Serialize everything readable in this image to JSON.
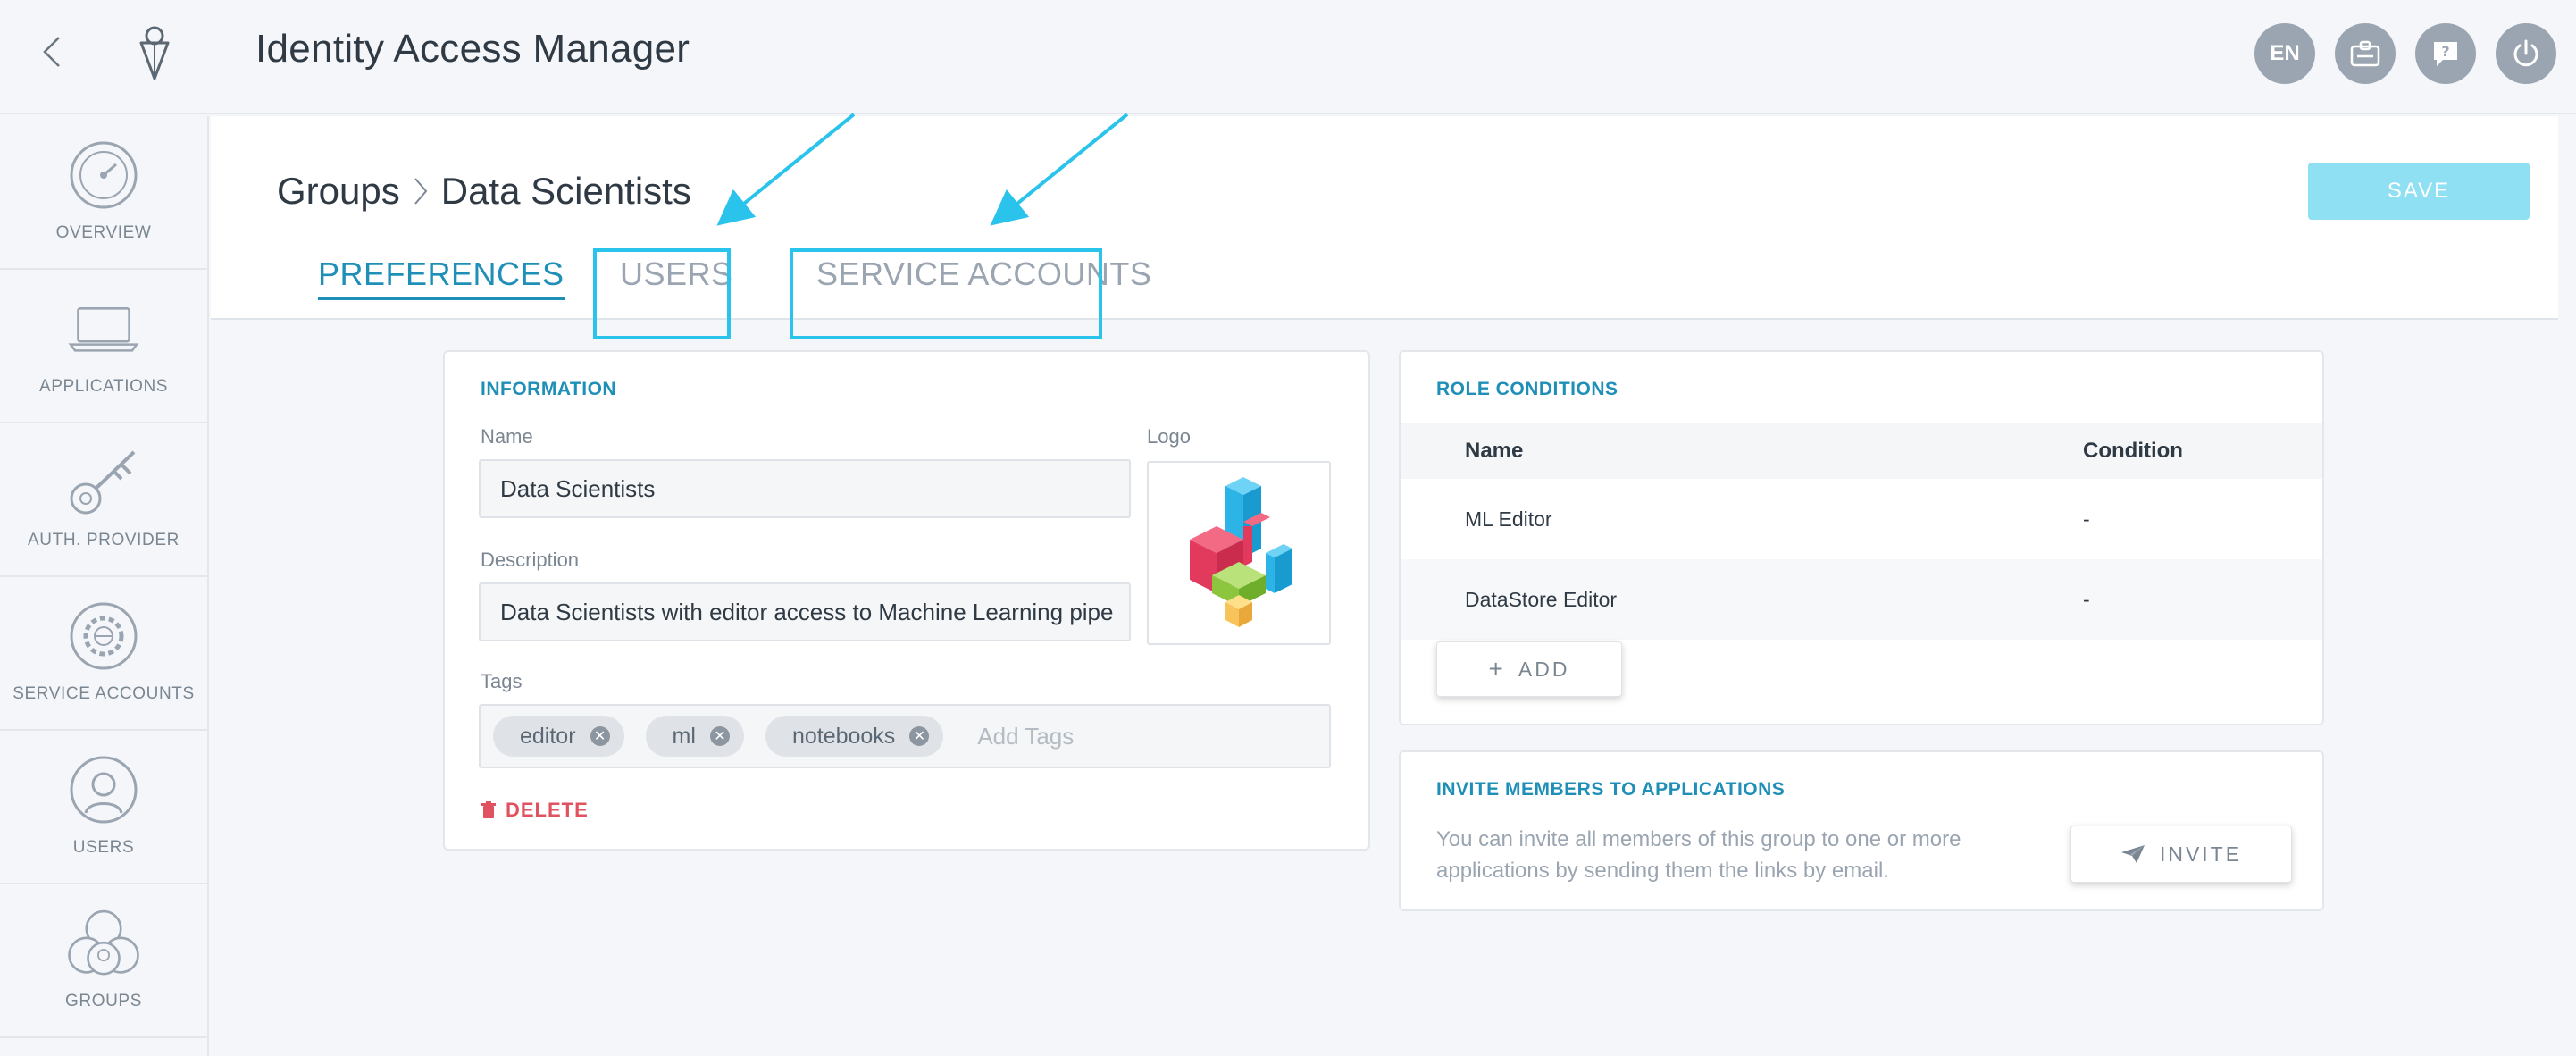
{
  "header": {
    "title": "Identity Access Manager",
    "language": "EN"
  },
  "sidebar": {
    "items": [
      {
        "label": "OVERVIEW",
        "icon": "speedometer-icon"
      },
      {
        "label": "APPLICATIONS",
        "icon": "laptop-icon"
      },
      {
        "label": "AUTH. PROVIDER",
        "icon": "key-icon"
      },
      {
        "label": "SERVICE ACCOUNTS",
        "icon": "gear-globe-icon"
      },
      {
        "label": "USERS",
        "icon": "user-icon"
      },
      {
        "label": "GROUPS",
        "icon": "group-icon"
      }
    ]
  },
  "page": {
    "breadcrumb_root": "Groups",
    "breadcrumb_current": "Data Scientists",
    "save_label": "SAVE",
    "tabs": [
      "PREFERENCES",
      "USERS",
      "SERVICE ACCOUNTS"
    ]
  },
  "information": {
    "title": "INFORMATION",
    "name_label": "Name",
    "name_value": "Data Scientists",
    "description_label": "Description",
    "description_value": "Data Scientists with editor access to Machine Learning pipe",
    "logo_label": "Logo",
    "tags_label": "Tags",
    "tags": [
      "editor",
      "ml",
      "notebooks"
    ],
    "tags_placeholder": "Add Tags",
    "delete_label": "DELETE"
  },
  "role_conditions": {
    "title": "ROLE CONDITIONS",
    "columns": [
      "Name",
      "Condition"
    ],
    "rows": [
      {
        "name": "ML Editor",
        "condition": "-"
      },
      {
        "name": "DataStore Editor",
        "condition": "-"
      }
    ],
    "add_label": "ADD"
  },
  "invite": {
    "title": "INVITE MEMBERS TO APPLICATIONS",
    "text": "You can invite all members of this group to one or more applications by sending them the links by email.",
    "button_label": "INVITE"
  },
  "colors": {
    "accent": "#1f8fb8",
    "highlight": "#29c3ec",
    "save_bg": "#8fe0f2",
    "delete": "#e0525f"
  }
}
